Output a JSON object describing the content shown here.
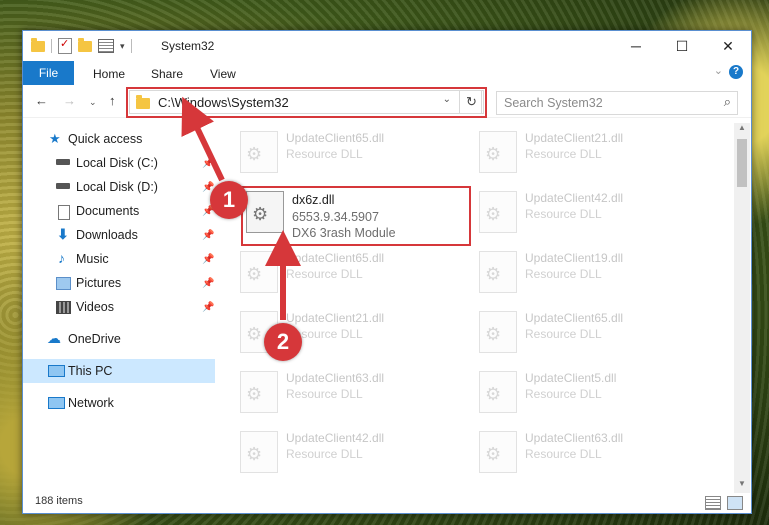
{
  "window": {
    "title": "System32"
  },
  "ribbon": {
    "file": "File",
    "tabs": [
      "Home",
      "Share",
      "View"
    ]
  },
  "address": {
    "path": "C:\\Windows\\System32"
  },
  "search": {
    "placeholder": "Search System32"
  },
  "sidebar": {
    "items": [
      {
        "label": "Quick access",
        "icon": "star-icon",
        "pinned": false
      },
      {
        "label": "Local Disk (C:)",
        "icon": "drive-icon",
        "pinned": true
      },
      {
        "label": "Local Disk (D:)",
        "icon": "drive-icon",
        "pinned": true
      },
      {
        "label": "Documents",
        "icon": "documents-icon",
        "pinned": true
      },
      {
        "label": "Downloads",
        "icon": "downloads-icon",
        "pinned": true
      },
      {
        "label": "Music",
        "icon": "music-icon",
        "pinned": true
      },
      {
        "label": "Pictures",
        "icon": "pictures-icon",
        "pinned": true
      },
      {
        "label": "Videos",
        "icon": "videos-icon",
        "pinned": true
      },
      {
        "label": "OneDrive",
        "icon": "onedrive-icon",
        "pinned": false
      },
      {
        "label": "This PC",
        "icon": "pc-icon",
        "pinned": false
      },
      {
        "label": "Network",
        "icon": "network-icon",
        "pinned": false
      }
    ]
  },
  "files": [
    {
      "name": "UpdateClient65.dll",
      "type": "Resource DLL"
    },
    {
      "name": "UpdateClient21.dll",
      "type": "Resource DLL"
    },
    {
      "name": "UpdateClient42.dll",
      "type": "Resource DLL"
    },
    {
      "name": "UpdateClient65.dll",
      "type": "Resource DLL"
    },
    {
      "name": "UpdateClient19.dll",
      "type": "Resource DLL"
    },
    {
      "name": "UpdateClient21.dll",
      "type": "Resource DLL"
    },
    {
      "name": "UpdateClient65.dll",
      "type": "Resource DLL"
    },
    {
      "name": "UpdateClient63.dll",
      "type": "Resource DLL"
    },
    {
      "name": "UpdateClient5.dll",
      "type": "Resource DLL"
    },
    {
      "name": "UpdateClient42.dll",
      "type": "Resource DLL"
    },
    {
      "name": "UpdateClient63.dll",
      "type": "Resource DLL"
    }
  ],
  "selected_file": {
    "name": "dx6z.dll",
    "version": "6553.9.34.5907",
    "description": "DX6 3rash Module"
  },
  "status": {
    "items": "188 items"
  },
  "annotations": {
    "step1": "1",
    "step2": "2"
  },
  "colors": {
    "accent": "#1979ca",
    "highlight": "#d6373a",
    "selection": "#cce8ff"
  }
}
